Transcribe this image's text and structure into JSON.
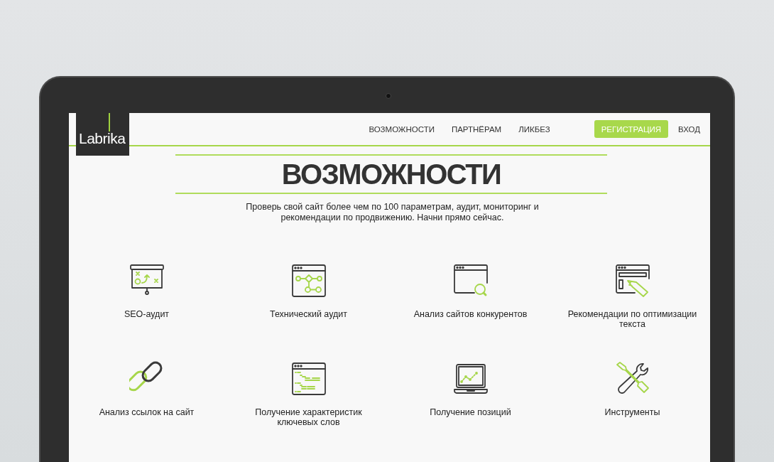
{
  "logo": "Labrika",
  "nav": [
    {
      "label": "ВОЗМОЖНОСТИ"
    },
    {
      "label": "ПАРТНЁРАМ"
    },
    {
      "label": "ЛИКБЕЗ"
    }
  ],
  "register_button": "РЕГИСТРАЦИЯ",
  "login_link": "ВХОД",
  "title": "ВОЗМОЖНОСТИ",
  "subtitle": "Проверь свой сайт более чем по 100 параметрам, аудит, мониторинг и рекомендации по продвижению. Начни прямо сейчас.",
  "features": [
    {
      "kind": "presentation",
      "label": "SEO-аудит"
    },
    {
      "kind": "flowchart",
      "label": "Технический аудит"
    },
    {
      "kind": "magnifier",
      "label": "Анализ сайтов конкурентов"
    },
    {
      "kind": "pencil",
      "label": "Рекомендации по оптимизации текста"
    },
    {
      "kind": "chain",
      "label": "Анализ ссылок на сайт"
    },
    {
      "kind": "code",
      "label": "Получение характеристик ключевых слов"
    },
    {
      "kind": "laptop",
      "label": "Получение позиций"
    },
    {
      "kind": "tools",
      "label": "Инструменты"
    }
  ]
}
